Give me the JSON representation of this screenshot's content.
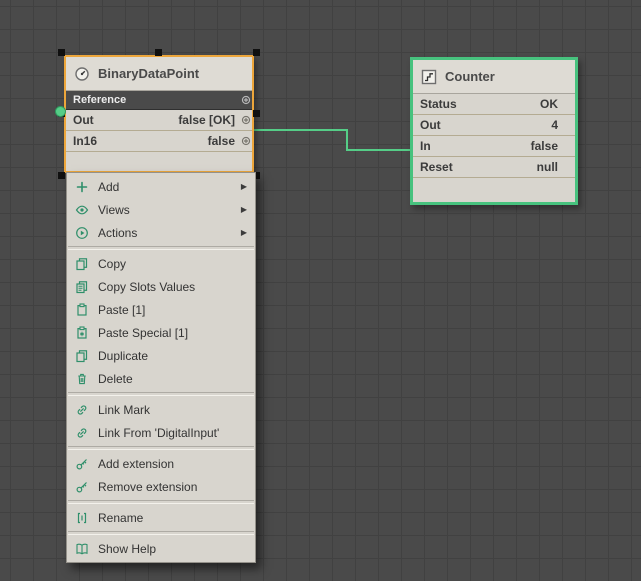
{
  "colors": {
    "selection_orange": "#EDA63B",
    "counter_green": "#47C27E",
    "wire_green": "#55CD87",
    "menu_icon_green": "#2F8F6A",
    "canvas_bg": "#4A4A4A"
  },
  "nodes": {
    "binary": {
      "title": "BinaryDataPoint",
      "title_icon": "point-icon",
      "rows": [
        {
          "label": "Reference",
          "value": ""
        },
        {
          "label": "Out",
          "value": "false [OK]"
        },
        {
          "label": "In16",
          "value": "false"
        }
      ]
    },
    "counter": {
      "title": "Counter",
      "title_icon": "counter-icon",
      "rows": [
        {
          "label": "Status",
          "value": "OK"
        },
        {
          "label": "Out",
          "value": "4"
        },
        {
          "label": "In",
          "value": "false"
        },
        {
          "label": "Reset",
          "value": "null"
        }
      ]
    }
  },
  "wire": {
    "from": "BinaryDataPoint.Out",
    "to": "Counter.In",
    "color": "#55CD87"
  },
  "menu": {
    "submenu_arrow": "▶",
    "items": [
      {
        "label": "Add",
        "icon": "add-icon",
        "submenu": true
      },
      {
        "label": "Views",
        "icon": "views-icon",
        "submenu": true
      },
      {
        "label": "Actions",
        "icon": "actions-icon",
        "submenu": true
      },
      {
        "label": "Copy",
        "icon": "copy-icon"
      },
      {
        "label": "Copy Slots Values",
        "icon": "copy-slots-icon"
      },
      {
        "label": "Paste [1]",
        "icon": "paste-icon"
      },
      {
        "label": "Paste Special [1]",
        "icon": "paste-special-icon"
      },
      {
        "label": "Duplicate",
        "icon": "duplicate-icon"
      },
      {
        "label": "Delete",
        "icon": "delete-icon"
      },
      {
        "label": "Link Mark",
        "icon": "link-mark-icon"
      },
      {
        "label": "Link From 'DigitalInput'",
        "icon": "link-from-icon"
      },
      {
        "label": "Add extension",
        "icon": "add-extension-icon"
      },
      {
        "label": "Remove extension",
        "icon": "remove-extension-icon"
      },
      {
        "label": "Rename",
        "icon": "rename-icon"
      },
      {
        "label": "Show Help",
        "icon": "show-help-icon"
      }
    ]
  }
}
